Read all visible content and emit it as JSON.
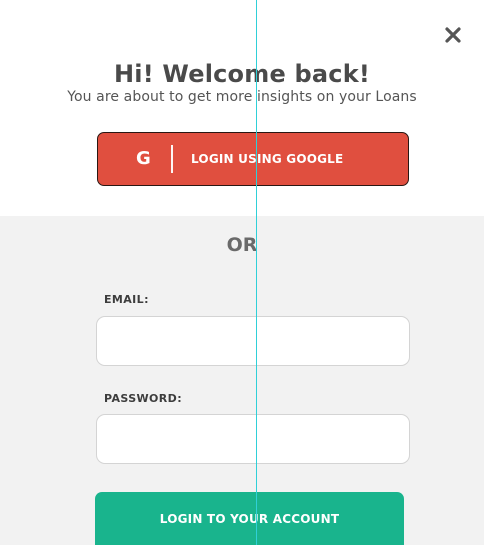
{
  "modal": {
    "title": "Hi! Welcome back!",
    "subtitle": "You are about to get more insights on your Loans",
    "close_icon": "close-icon",
    "close_glyph": "✕"
  },
  "google": {
    "icon_text": "G",
    "label": "LOGIN USING GOOGLE",
    "color": "#e04f3f"
  },
  "divider": {
    "or_text": "OR"
  },
  "form": {
    "email_label": "EMAIL:",
    "email_value": "",
    "password_label": "PASSWORD:",
    "password_value": "",
    "submit_label": "LOGIN TO YOUR ACCOUNT",
    "submit_color": "#19b48d"
  },
  "colors": {
    "background_top": "#ffffff",
    "background_bottom": "#f2f2f2",
    "guide_line": "#2fd0d8"
  }
}
